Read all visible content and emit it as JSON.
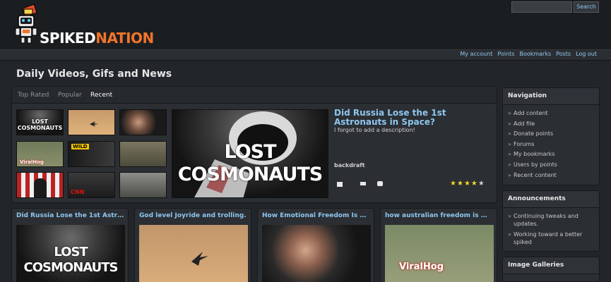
{
  "header": {
    "logo_text_white": "SPIKED",
    "logo_text_orange": "NATION",
    "search_button": "Search",
    "search_placeholder": ""
  },
  "userbar": {
    "links": [
      "My account",
      "Points",
      "Bookmarks",
      "Posts",
      "Log out"
    ]
  },
  "page_title": "Daily Videos, Gifs and News",
  "featured": {
    "tabs": [
      {
        "label": "Top Rated",
        "active": false
      },
      {
        "label": "Popular",
        "active": false
      },
      {
        "label": "Recent",
        "active": true
      }
    ],
    "thumb_labels": [
      "LOST COSMONAUTS",
      "WILD",
      "CNN",
      "ViralHog"
    ],
    "image_caption": "LOST COSMONAUTS",
    "title": "Did Russia Lose the 1st Astronauts in Space?",
    "description": "I forgot to add a description!",
    "author": "backdraft",
    "rating": 4.5
  },
  "cards": [
    {
      "title": "Did Russia Lose the 1st Astron...",
      "caption": "LOST COSMONAUTS"
    },
    {
      "title": "God level Joyride and trolling.",
      "caption": ""
    },
    {
      "title": "How Emotional Freedom Is Ma...",
      "caption": ""
    },
    {
      "title": "how australian freedom is made",
      "caption": "ViralHog"
    }
  ],
  "sidebar": {
    "navigation": {
      "title": "Navigation",
      "items": [
        "Add content",
        "Add file",
        "Donate points",
        "Forums",
        "My bookmarks",
        "Users by points",
        "Recent content"
      ]
    },
    "announcements": {
      "title": "Announcements",
      "items": [
        "Continuing tweaks and updates.",
        "Working toward a better spiked"
      ]
    },
    "galleries": {
      "title": "Image Galleries"
    }
  },
  "colors": {
    "link": "#8fc6ef",
    "logo_orange": "#f0742a",
    "star": "#f2d93a",
    "panel": "#2b2f33"
  }
}
